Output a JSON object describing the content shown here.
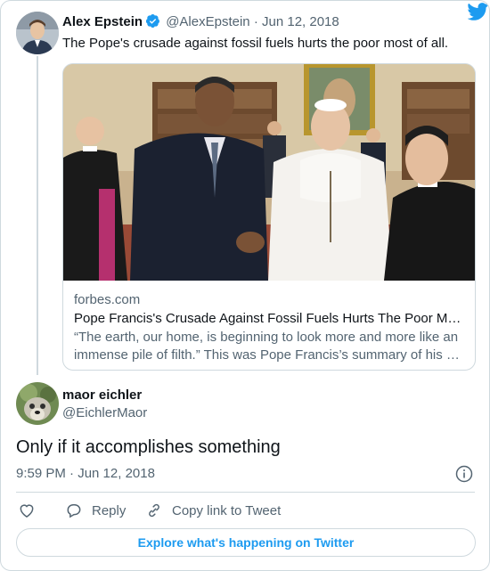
{
  "parent_tweet": {
    "author_name": "Alex Epstein",
    "handle": "@AlexEpstein",
    "separator": "·",
    "date": "Jun 12, 2018",
    "text": "The Pope's crusade against fossil fuels hurts the poor most of all.",
    "verified_icon": "verified-badge-icon",
    "link_card": {
      "image": "photo of Barack Obama meeting Pope Francis",
      "domain": "forbes.com",
      "title": "Pope Francis's Crusade Against Fossil Fuels Hurts The Poor M…",
      "description": "“The earth, our home, is beginning to look more and more like an immense pile of filth.” This was Pope Francis’s summary of his …"
    }
  },
  "reply_tweet": {
    "author_name": "maor eichler",
    "handle": "@EichlerMaor",
    "text": "Only if it accomplishes something",
    "timestamp": "9:59 PM · Jun 12, 2018"
  },
  "actions": {
    "like_icon": "heart-icon",
    "reply_label": "Reply",
    "copy_link_label": "Copy link to Tweet"
  },
  "footer": {
    "explore_label": "Explore what's happening on Twitter"
  },
  "colors": {
    "accent": "#1d9bf0",
    "secondary_text": "#536471",
    "border": "#cfd9de"
  }
}
